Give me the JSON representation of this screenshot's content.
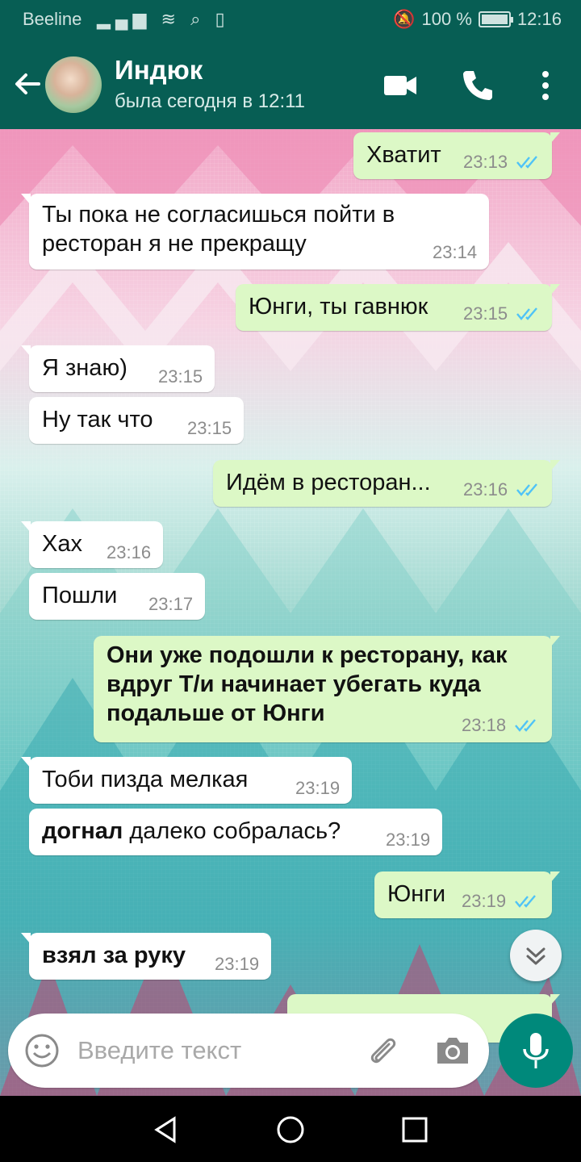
{
  "status_bar": {
    "carrier": "Beeline",
    "battery": "100 %",
    "battery_level": 1.0,
    "time": "12:16"
  },
  "header": {
    "contact_name": "Индюк",
    "last_seen": "была сегодня в 12:11",
    "icons": [
      "back-arrow-icon",
      "video-call-icon",
      "phone-icon",
      "more-vert-icon"
    ]
  },
  "messages": [
    {
      "direction": "out",
      "text": "Хватит",
      "time": "23:13"
    },
    {
      "direction": "in",
      "text": "Ты пока не согласишься пойти в ресторан я не прекращу",
      "time": "23:14"
    },
    {
      "direction": "out",
      "text": "Юнги, ты гавнюк",
      "time": "23:15"
    },
    {
      "direction": "in",
      "text": "Я знаю)",
      "time": "23:15"
    },
    {
      "direction": "in",
      "text": "Ну так что",
      "time": "23:15"
    },
    {
      "direction": "out",
      "text": "Идём в ресторан...",
      "time": "23:16"
    },
    {
      "direction": "in",
      "text": "Хах",
      "time": "23:16"
    },
    {
      "direction": "in",
      "text": "Пошли",
      "time": "23:17"
    },
    {
      "direction": "out",
      "text": "Они уже подошли к ресторану, как вдруг Т/и начинает убегать куда подальше от Юнги",
      "time": "23:18",
      "bold": true
    },
    {
      "direction": "in",
      "text": "Тоби пизда мелкая",
      "time": "23:19"
    },
    {
      "direction": "in",
      "bold_prefix": "догнал",
      "text": "далеко собралась?",
      "time": "23:19"
    },
    {
      "direction": "out",
      "text": "Юнги",
      "time": "23:19"
    },
    {
      "direction": "in",
      "text": "взял за руку",
      "time": "23:19",
      "bold": true
    }
  ],
  "input": {
    "placeholder": "Введите текст",
    "icons": [
      "emoji-icon",
      "attach-icon",
      "camera-icon",
      "mic-icon"
    ]
  },
  "colors": {
    "header": "#075e54",
    "outgoing_bubble": "#dcf8c6",
    "incoming_bubble": "#ffffff",
    "read_ticks": "#4fc3f7",
    "mic_button": "#00897b"
  }
}
